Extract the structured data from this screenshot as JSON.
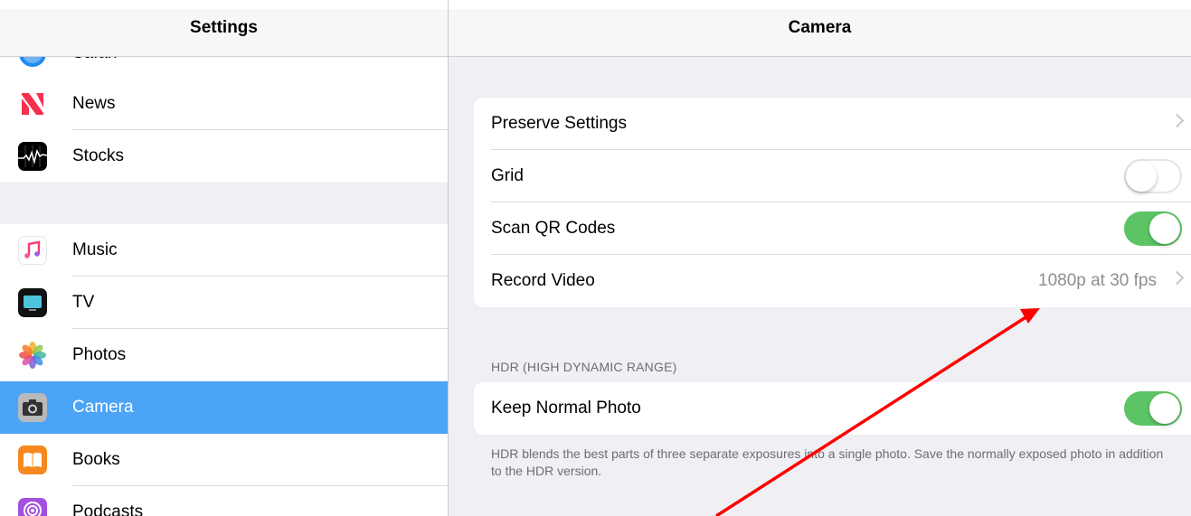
{
  "sidebar": {
    "title": "Settings",
    "cut_item": "Safari",
    "group1": [
      {
        "label": "News",
        "icon": "news-icon"
      },
      {
        "label": "Stocks",
        "icon": "stocks-icon"
      }
    ],
    "group2": [
      {
        "label": "Music",
        "icon": "music-icon"
      },
      {
        "label": "TV",
        "icon": "tv-icon"
      },
      {
        "label": "Photos",
        "icon": "photos-icon"
      },
      {
        "label": "Camera",
        "icon": "camera-icon",
        "selected": true
      },
      {
        "label": "Books",
        "icon": "books-icon"
      },
      {
        "label": "Podcasts",
        "icon": "podcasts-icon"
      }
    ]
  },
  "detail": {
    "title": "Camera",
    "rows": {
      "preserve": {
        "label": "Preserve Settings"
      },
      "grid": {
        "label": "Grid",
        "on": false
      },
      "qr": {
        "label": "Scan QR Codes",
        "on": true
      },
      "record": {
        "label": "Record Video",
        "value": "1080p at 30 fps"
      }
    },
    "hdr": {
      "section_label": "HDR (HIGH DYNAMIC RANGE)",
      "keep_normal": {
        "label": "Keep Normal Photo",
        "on": true
      },
      "footnote": "HDR blends the best parts of three separate exposures into a single photo. Save the normally exposed photo in addition to the HDR version."
    }
  },
  "colors": {
    "selection": "#4ca4f7",
    "toggle_on": "#5cc465",
    "annotation_arrow": "#ff0000"
  }
}
